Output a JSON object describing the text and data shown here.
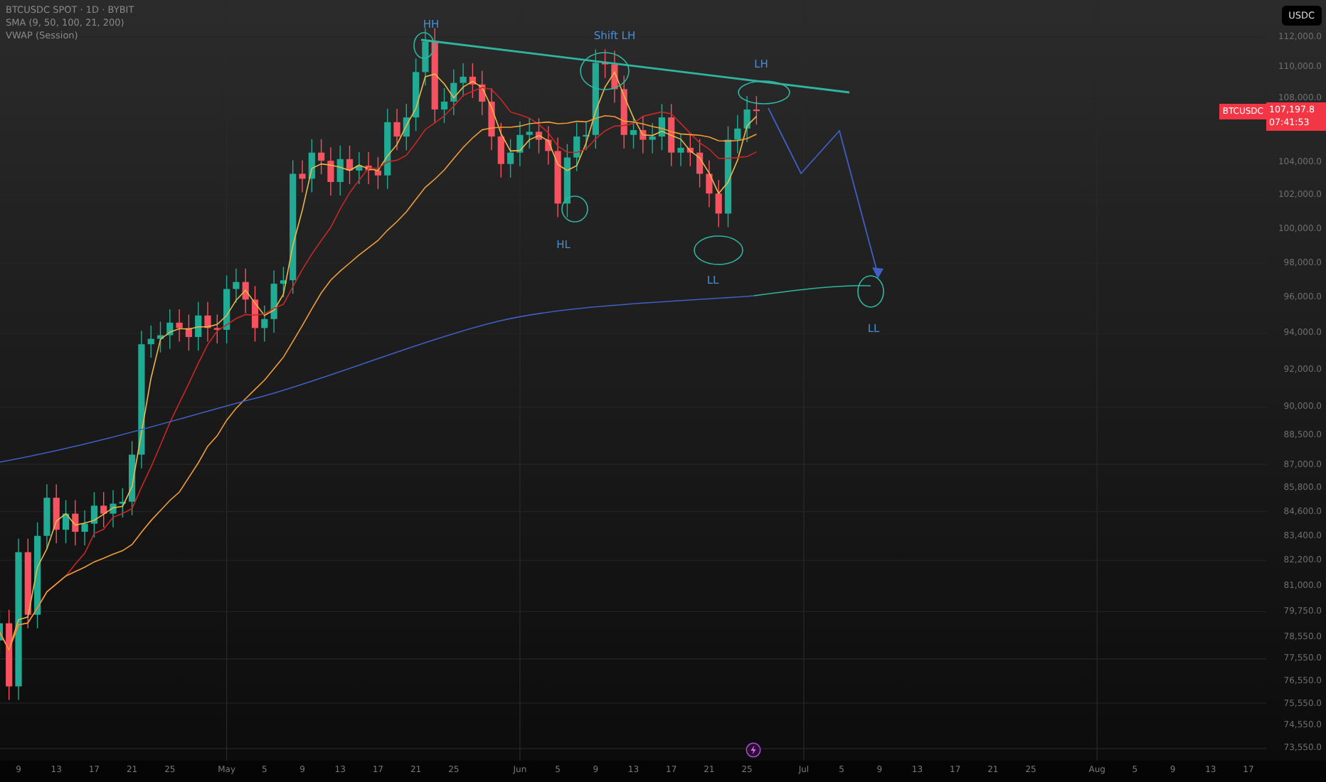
{
  "legend": [
    "BTCUSDC SPOT · 1D · BYBIT",
    "SMA (9, 50, 100, 21, 200)",
    "VWAP (Session)"
  ],
  "annotations": [
    {
      "text": "HH"
    },
    {
      "text": "Shift LH"
    },
    {
      "text": "LH"
    },
    {
      "text": "HL"
    },
    {
      "text": "LL"
    },
    {
      "text": "LL"
    }
  ],
  "price_axis": {
    "currency": "USDC",
    "ticks": [
      "112,000.0",
      "110,000.0",
      "108,000.0",
      "104,000.0",
      "102,000.0",
      "100,000.0",
      "98,000.0",
      "96,000.0",
      "94,000.0",
      "92,000.0",
      "90,000.0",
      "88,500.0",
      "87,000.0",
      "85,800.0",
      "84,600.0",
      "83,400.0",
      "82,200.0",
      "81,000.0",
      "79,750.0",
      "78,550.0",
      "77,550.0",
      "76,550.0",
      "75,550.0",
      "74,550.0",
      "73,550.0"
    ]
  },
  "price_tag": {
    "symbol": "BTCUSDC",
    "price": "107,197.8",
    "countdown": "07:41:53"
  },
  "time_axis": {
    "ticks": [
      "9",
      "13",
      "17",
      "21",
      "25",
      "May",
      "5",
      "9",
      "13",
      "17",
      "21",
      "25",
      "Jun",
      "5",
      "9",
      "13",
      "17",
      "21",
      "25",
      "Jul",
      "5",
      "9",
      "13",
      "17",
      "21",
      "25",
      "Aug",
      "5",
      "9",
      "13",
      "17"
    ]
  }
}
